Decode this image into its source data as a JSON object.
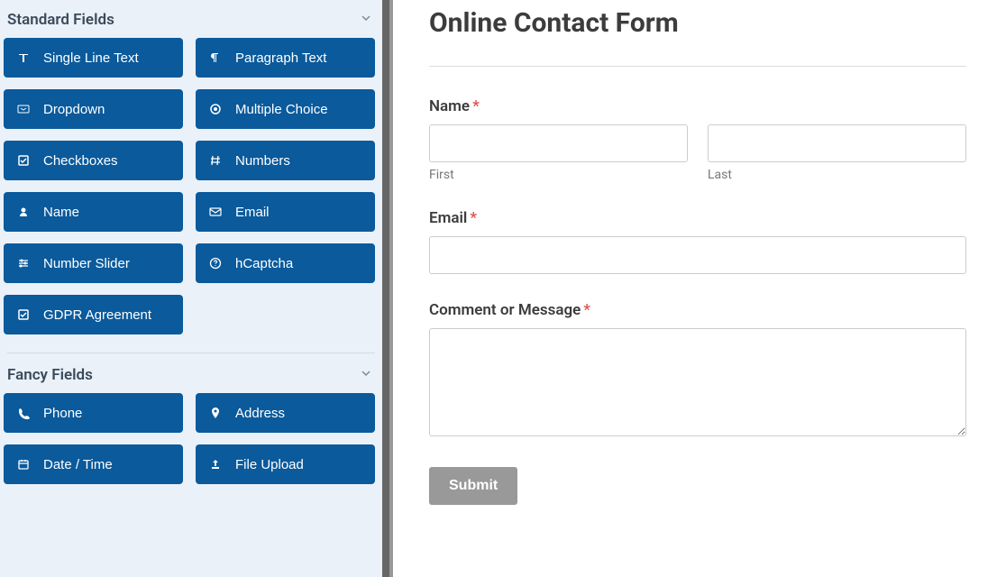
{
  "sidebar": {
    "sections": [
      {
        "title": "Standard Fields",
        "items": [
          {
            "icon": "text",
            "label": "Single Line Text"
          },
          {
            "icon": "paragraph",
            "label": "Paragraph Text"
          },
          {
            "icon": "dropdown",
            "label": "Dropdown"
          },
          {
            "icon": "radio",
            "label": "Multiple Choice"
          },
          {
            "icon": "checkbox",
            "label": "Checkboxes"
          },
          {
            "icon": "hash",
            "label": "Numbers"
          },
          {
            "icon": "user",
            "label": "Name"
          },
          {
            "icon": "envelope",
            "label": "Email"
          },
          {
            "icon": "slider",
            "label": "Number Slider"
          },
          {
            "icon": "question",
            "label": "hCaptcha"
          },
          {
            "icon": "checkbox",
            "label": "GDPR Agreement"
          }
        ]
      },
      {
        "title": "Fancy Fields",
        "items": [
          {
            "icon": "phone",
            "label": "Phone"
          },
          {
            "icon": "pin",
            "label": "Address"
          },
          {
            "icon": "calendar",
            "label": "Date / Time"
          },
          {
            "icon": "upload",
            "label": "File Upload"
          }
        ]
      }
    ]
  },
  "form": {
    "title": "Online Contact Form",
    "name_label": "Name",
    "first_sublabel": "First",
    "last_sublabel": "Last",
    "email_label": "Email",
    "comment_label": "Comment or Message",
    "submit_label": "Submit",
    "required_marker": "*"
  }
}
